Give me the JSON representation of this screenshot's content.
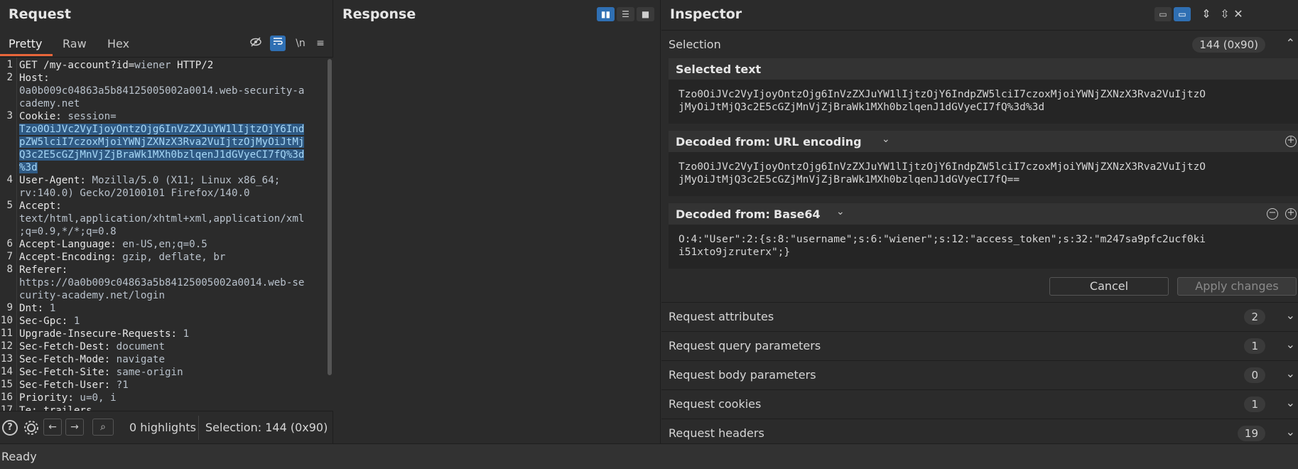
{
  "request": {
    "title": "Request",
    "tabs": [
      "Pretty",
      "Raw",
      "Hex"
    ],
    "toolbar_icons": [
      "eye-off-icon",
      "wrap-icon",
      "newline-icon",
      "menu-icon"
    ],
    "newline_label": "\\n",
    "lines": [
      {
        "n": "1",
        "parts": [
          {
            "t": "GET /my-account?id=",
            "c": "k"
          },
          {
            "t": "wiener",
            "c": "v"
          },
          {
            "t": " HTTP/2",
            "c": "k"
          }
        ]
      },
      {
        "n": "2",
        "parts": [
          {
            "t": "Host:",
            "c": "k"
          }
        ]
      },
      {
        "n": "",
        "parts": [
          {
            "t": "0a0b009c04863a5b84125005002a0014.web-security-a",
            "c": "v"
          }
        ]
      },
      {
        "n": "",
        "parts": [
          {
            "t": "cademy.net",
            "c": "v"
          }
        ]
      },
      {
        "n": "3",
        "parts": [
          {
            "t": "Cookie: ",
            "c": "k"
          },
          {
            "t": "session=",
            "c": "v"
          }
        ]
      },
      {
        "n": "",
        "parts": [
          {
            "t": "Tzo0OiJVc2VyIjoyOntzOjg6InVzZXJuYW1lIjtzOjY6Ind",
            "c": "hl"
          }
        ]
      },
      {
        "n": "",
        "parts": [
          {
            "t": "pZW5lciI7czoxMjoiYWNjZXNzX3Rva2VuIjtzOjMyOiJtMj",
            "c": "hl"
          }
        ]
      },
      {
        "n": "",
        "parts": [
          {
            "t": "Q3c2E5cGZjMnVjZjBraWk1MXh0bzlqenJ1dGVyeCI7fQ%3d",
            "c": "hl"
          }
        ]
      },
      {
        "n": "",
        "parts": [
          {
            "t": "%3d",
            "c": "hl"
          }
        ]
      },
      {
        "n": "4",
        "parts": [
          {
            "t": "User-Agent: ",
            "c": "k"
          },
          {
            "t": "Mozilla/5.0 (X11; Linux x86_64;",
            "c": "v"
          }
        ]
      },
      {
        "n": "",
        "parts": [
          {
            "t": "rv:140.0) Gecko/20100101 Firefox/140.0",
            "c": "v"
          }
        ]
      },
      {
        "n": "5",
        "parts": [
          {
            "t": "Accept:",
            "c": "k"
          }
        ]
      },
      {
        "n": "",
        "parts": [
          {
            "t": "text/html,application/xhtml+xml,application/xml",
            "c": "v"
          }
        ]
      },
      {
        "n": "",
        "parts": [
          {
            "t": ";q=0.9,*/*;q=0.8",
            "c": "v"
          }
        ]
      },
      {
        "n": "6",
        "parts": [
          {
            "t": "Accept-Language: ",
            "c": "k"
          },
          {
            "t": "en-US,en;q=0.5",
            "c": "v"
          }
        ]
      },
      {
        "n": "7",
        "parts": [
          {
            "t": "Accept-Encoding: ",
            "c": "k"
          },
          {
            "t": "gzip, deflate, br",
            "c": "v"
          }
        ]
      },
      {
        "n": "8",
        "parts": [
          {
            "t": "Referer:",
            "c": "k"
          }
        ]
      },
      {
        "n": "",
        "parts": [
          {
            "t": "https://0a0b009c04863a5b84125005002a0014.web-se",
            "c": "v"
          }
        ]
      },
      {
        "n": "",
        "parts": [
          {
            "t": "curity-academy.net/login",
            "c": "v"
          }
        ]
      },
      {
        "n": "9",
        "parts": [
          {
            "t": "Dnt: ",
            "c": "k"
          },
          {
            "t": "1",
            "c": "v"
          }
        ]
      },
      {
        "n": "10",
        "parts": [
          {
            "t": "Sec-Gpc: ",
            "c": "k"
          },
          {
            "t": "1",
            "c": "v"
          }
        ]
      },
      {
        "n": "11",
        "parts": [
          {
            "t": "Upgrade-Insecure-Requests: ",
            "c": "k"
          },
          {
            "t": "1",
            "c": "v"
          }
        ]
      },
      {
        "n": "12",
        "parts": [
          {
            "t": "Sec-Fetch-Dest: ",
            "c": "k"
          },
          {
            "t": "document",
            "c": "v"
          }
        ]
      },
      {
        "n": "13",
        "parts": [
          {
            "t": "Sec-Fetch-Mode: ",
            "c": "k"
          },
          {
            "t": "navigate",
            "c": "v"
          }
        ]
      },
      {
        "n": "14",
        "parts": [
          {
            "t": "Sec-Fetch-Site: ",
            "c": "k"
          },
          {
            "t": "same-origin",
            "c": "v"
          }
        ]
      },
      {
        "n": "15",
        "parts": [
          {
            "t": "Sec-Fetch-User: ",
            "c": "k"
          },
          {
            "t": "?1",
            "c": "v"
          }
        ]
      },
      {
        "n": "16",
        "parts": [
          {
            "t": "Priority: ",
            "c": "k"
          },
          {
            "t": "u=0, i",
            "c": "v"
          }
        ]
      },
      {
        "n": "17",
        "parts": [
          {
            "t": "Te: trailers",
            "c": "k"
          }
        ]
      }
    ],
    "bottom": {
      "highlights": "0 highlights",
      "selection": "Selection: 144 (0x90)"
    }
  },
  "response": {
    "title": "Response"
  },
  "inspector": {
    "title": "Inspector",
    "selection": {
      "label": "Selection",
      "count": "144 (0x90)"
    },
    "selected_text": {
      "label": "Selected text",
      "lines": [
        "Tzo0OiJVc2VyIjoyOntzOjg6InVzZXJuYW1lIjtzOjY6IndpZW5lciI7czoxMjoiYWNjZXNzX3Rva2VuIjtzO",
        "jMyOiJtMjQ3c2E5cGZjMnVjZjBraWk1MXh0bzlqenJ1dGVyeCI7fQ%3d%3d"
      ]
    },
    "decoded_url": {
      "label": "Decoded from:",
      "encoding": "URL encoding",
      "lines": [
        "Tzo0OiJVc2VyIjoyOntzOjg6InVzZXJuYW1lIjtzOjY6IndpZW5lciI7czoxMjoiYWNjZXNzX3Rva2VuIjtzO",
        "jMyOiJtMjQ3c2E5cGZjMnVjZjBraWk1MXh0bzlqenJ1dGVyeCI7fQ=="
      ]
    },
    "decoded_b64": {
      "label": "Decoded from:",
      "encoding": "Base64",
      "lines": [
        "O:4:\"User\":2:{s:8:\"username\";s:6:\"wiener\";s:12:\"access_token\";s:32:\"m247sa9pfc2ucf0ki",
        "i51xto9jzruterx\";}"
      ]
    },
    "buttons": {
      "cancel": "Cancel",
      "apply": "Apply changes"
    },
    "sections": [
      {
        "label": "Request attributes",
        "count": "2"
      },
      {
        "label": "Request query parameters",
        "count": "1"
      },
      {
        "label": "Request body parameters",
        "count": "0"
      },
      {
        "label": "Request cookies",
        "count": "1"
      },
      {
        "label": "Request headers",
        "count": "19"
      }
    ]
  },
  "status": "Ready"
}
